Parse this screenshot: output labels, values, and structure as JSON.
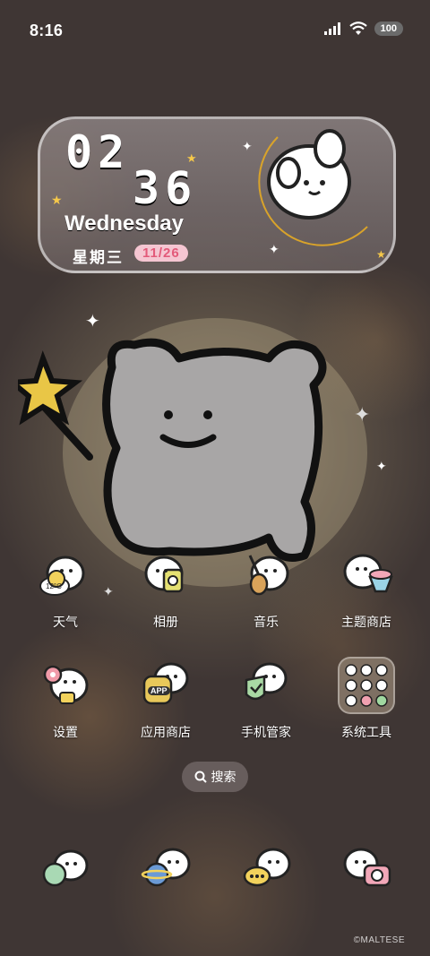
{
  "status_bar": {
    "time": "8:16",
    "battery": "100"
  },
  "widget": {
    "hour": "02",
    "minute": "36",
    "weekday": "Wednesday",
    "weekday_cn": "星期三",
    "date": "11/26"
  },
  "apps_row1": [
    {
      "label": "天气",
      "icon": "weather-bear-icon",
      "temp": "12°C"
    },
    {
      "label": "相册",
      "icon": "gallery-bear-icon"
    },
    {
      "label": "音乐",
      "icon": "music-bear-icon"
    },
    {
      "label": "主题商店",
      "icon": "theme-store-bear-icon"
    }
  ],
  "apps_row2": [
    {
      "label": "设置",
      "icon": "settings-bear-icon"
    },
    {
      "label": "应用商店",
      "icon": "app-store-bear-icon",
      "badge": "APP"
    },
    {
      "label": "手机管家",
      "icon": "phone-manager-bear-icon"
    },
    {
      "label": "系统工具",
      "icon": "system-tools-folder-icon"
    }
  ],
  "search": {
    "label": "搜索"
  },
  "dock": [
    {
      "icon": "phone-bear-icon"
    },
    {
      "icon": "browser-bear-icon"
    },
    {
      "icon": "messages-bear-icon"
    },
    {
      "icon": "camera-bear-icon"
    }
  ],
  "credit": "©MALTESE",
  "colors": {
    "wallpaper": "#3f3634",
    "date_pill": "#f5c6d2",
    "date_text": "#e35a7a",
    "moon": "#f5c84a"
  }
}
